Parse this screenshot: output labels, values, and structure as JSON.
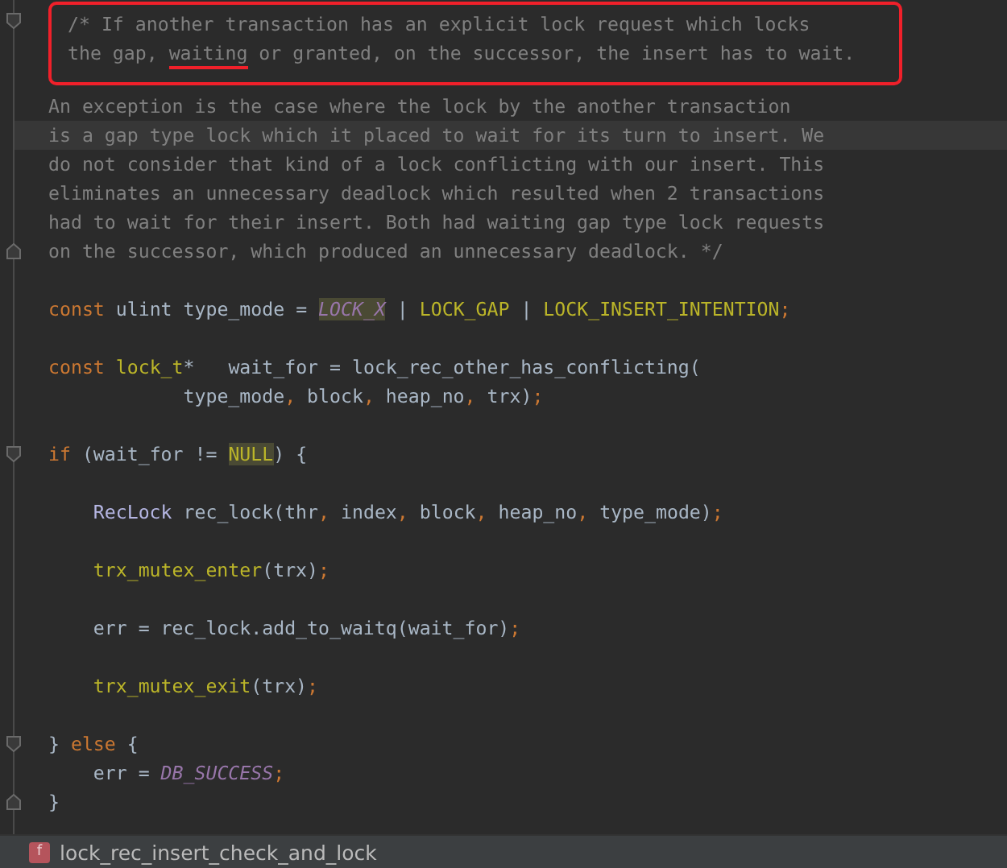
{
  "editor": {
    "annotated_lines": [
      {
        "fold_start": true,
        "current": false,
        "tokens": [
          {
            "text": "/* If another transaction has an explicit lock request which locks",
            "kind": "comment",
            "marked": false,
            "underlined": false
          }
        ]
      },
      {
        "fold_start": false,
        "current": false,
        "tokens": [
          {
            "text": "the gap, ",
            "kind": "comment",
            "marked": false,
            "underlined": false
          },
          {
            "text": "waiting",
            "kind": "comment",
            "marked": false,
            "underlined": true
          },
          {
            "text": " or granted, on the successor, the insert has to wait.",
            "kind": "comment",
            "marked": false,
            "underlined": false
          }
        ]
      }
    ],
    "lines": [
      {
        "kind": "top",
        "fold_start": false,
        "fold_end": false,
        "current": false,
        "space_before": false,
        "tokens": [
          {
            "text": "An exception is the case where the lock by the another transaction",
            "kind": "comment",
            "marked": false
          }
        ]
      },
      {
        "kind": "top",
        "fold_start": false,
        "fold_end": false,
        "current": true,
        "space_before": false,
        "tokens": [
          {
            "text": "is a gap type lock which it placed to wait for its turn to insert. We",
            "kind": "comment",
            "marked": false
          }
        ]
      },
      {
        "kind": "top",
        "fold_start": false,
        "fold_end": false,
        "current": false,
        "space_before": false,
        "tokens": [
          {
            "text": "do not consider that kind of a lock conflicting with our insert. This",
            "kind": "comment",
            "marked": false
          }
        ]
      },
      {
        "kind": "top",
        "fold_start": false,
        "fold_end": false,
        "current": false,
        "space_before": false,
        "tokens": [
          {
            "text": "eliminates an unnecessary deadlock which resulted when 2 transactions",
            "kind": "comment",
            "marked": false
          }
        ]
      },
      {
        "kind": "top",
        "fold_start": false,
        "fold_end": false,
        "current": false,
        "space_before": false,
        "tokens": [
          {
            "text": "had to wait for their insert. Both had waiting gap type lock requests",
            "kind": "comment",
            "marked": false
          }
        ]
      },
      {
        "kind": "top",
        "fold_start": false,
        "fold_end": true,
        "current": false,
        "space_before": false,
        "tokens": [
          {
            "text": "on the successor, which produced an unnecessary deadlock. */",
            "kind": "comment",
            "marked": false
          }
        ]
      },
      {
        "kind": "top",
        "fold_start": false,
        "fold_end": false,
        "current": false,
        "space_before": true,
        "tokens": [
          {
            "text": "const",
            "kind": "keyword",
            "marked": false
          },
          {
            "text": " ulint type_mode = ",
            "kind": "plain",
            "marked": false
          },
          {
            "text": "LOCK_X",
            "kind": "constant",
            "marked": true
          },
          {
            "text": " | ",
            "kind": "plain",
            "marked": false
          },
          {
            "text": "LOCK_GAP",
            "kind": "macro",
            "marked": false
          },
          {
            "text": " | ",
            "kind": "plain",
            "marked": false
          },
          {
            "text": "LOCK_INSERT_INTENTION",
            "kind": "macro",
            "marked": false
          },
          {
            "text": ";",
            "kind": "punct",
            "marked": false
          }
        ]
      },
      {
        "kind": "top",
        "fold_start": false,
        "fold_end": false,
        "current": false,
        "space_before": true,
        "tokens": [
          {
            "text": "const",
            "kind": "keyword",
            "marked": false
          },
          {
            "text": " lock_t",
            "kind": "macro",
            "marked": false
          },
          {
            "text": "*   wait_for = lock_rec_other_has_conflicting(",
            "kind": "plain",
            "marked": false
          }
        ]
      },
      {
        "kind": "continuation",
        "fold_start": false,
        "fold_end": false,
        "current": false,
        "space_before": false,
        "tokens": [
          {
            "text": "type_mode",
            "kind": "plain",
            "marked": false
          },
          {
            "text": ", ",
            "kind": "punct",
            "marked": false
          },
          {
            "text": "block",
            "kind": "plain",
            "marked": false
          },
          {
            "text": ", ",
            "kind": "punct",
            "marked": false
          },
          {
            "text": "heap_no",
            "kind": "plain",
            "marked": false
          },
          {
            "text": ", ",
            "kind": "punct",
            "marked": false
          },
          {
            "text": "trx)",
            "kind": "plain",
            "marked": false
          },
          {
            "text": ";",
            "kind": "punct",
            "marked": false
          }
        ]
      },
      {
        "kind": "top",
        "fold_start": true,
        "fold_end": false,
        "current": false,
        "space_before": true,
        "tokens": [
          {
            "text": "if",
            "kind": "keyword",
            "marked": false
          },
          {
            "text": " (wait_for != ",
            "kind": "plain",
            "marked": false
          },
          {
            "text": "NULL",
            "kind": "macro",
            "marked": true
          },
          {
            "text": ") {",
            "kind": "plain",
            "marked": false
          }
        ]
      },
      {
        "kind": "inner",
        "fold_start": false,
        "fold_end": false,
        "current": false,
        "space_before": true,
        "tokens": [
          {
            "text": "RecLock",
            "kind": "class",
            "marked": false
          },
          {
            "text": " rec_lock(thr",
            "kind": "plain",
            "marked": false
          },
          {
            "text": ", ",
            "kind": "punct",
            "marked": false
          },
          {
            "text": "index",
            "kind": "plain",
            "marked": false
          },
          {
            "text": ", ",
            "kind": "punct",
            "marked": false
          },
          {
            "text": "block",
            "kind": "plain",
            "marked": false
          },
          {
            "text": ", ",
            "kind": "punct",
            "marked": false
          },
          {
            "text": "heap_no",
            "kind": "plain",
            "marked": false
          },
          {
            "text": ", ",
            "kind": "punct",
            "marked": false
          },
          {
            "text": "type_mode)",
            "kind": "plain",
            "marked": false
          },
          {
            "text": ";",
            "kind": "punct",
            "marked": false
          }
        ]
      },
      {
        "kind": "inner",
        "fold_start": false,
        "fold_end": false,
        "current": false,
        "space_before": true,
        "tokens": [
          {
            "text": "trx_mutex_enter",
            "kind": "macro",
            "marked": false
          },
          {
            "text": "(trx)",
            "kind": "plain",
            "marked": false
          },
          {
            "text": ";",
            "kind": "punct",
            "marked": false
          }
        ]
      },
      {
        "kind": "inner",
        "fold_start": false,
        "fold_end": false,
        "current": false,
        "space_before": true,
        "tokens": [
          {
            "text": "err = rec_lock.add_to_waitq(wait_for)",
            "kind": "plain",
            "marked": false
          },
          {
            "text": ";",
            "kind": "punct",
            "marked": false
          }
        ]
      },
      {
        "kind": "inner",
        "fold_start": false,
        "fold_end": false,
        "current": false,
        "space_before": true,
        "tokens": [
          {
            "text": "trx_mutex_exit",
            "kind": "macro",
            "marked": false
          },
          {
            "text": "(trx)",
            "kind": "plain",
            "marked": false
          },
          {
            "text": ";",
            "kind": "punct",
            "marked": false
          }
        ]
      },
      {
        "kind": "top",
        "fold_start": true,
        "fold_end": false,
        "current": false,
        "space_before": true,
        "tokens": [
          {
            "text": "} ",
            "kind": "plain",
            "marked": false
          },
          {
            "text": "else",
            "kind": "keyword",
            "marked": false
          },
          {
            "text": " {",
            "kind": "plain",
            "marked": false
          }
        ]
      },
      {
        "kind": "inner",
        "fold_start": false,
        "fold_end": false,
        "current": false,
        "space_before": false,
        "tokens": [
          {
            "text": "err = ",
            "kind": "plain",
            "marked": false
          },
          {
            "text": "DB_SUCCESS",
            "kind": "constant",
            "marked": false
          },
          {
            "text": ";",
            "kind": "punct",
            "marked": false
          }
        ]
      },
      {
        "kind": "top",
        "fold_start": false,
        "fold_end": true,
        "current": false,
        "space_before": false,
        "tokens": [
          {
            "text": "}",
            "kind": "plain",
            "marked": false
          }
        ]
      }
    ]
  },
  "status_bar": {
    "icon_letter": "f",
    "function_name": "lock_rec_insert_check_and_lock"
  }
}
